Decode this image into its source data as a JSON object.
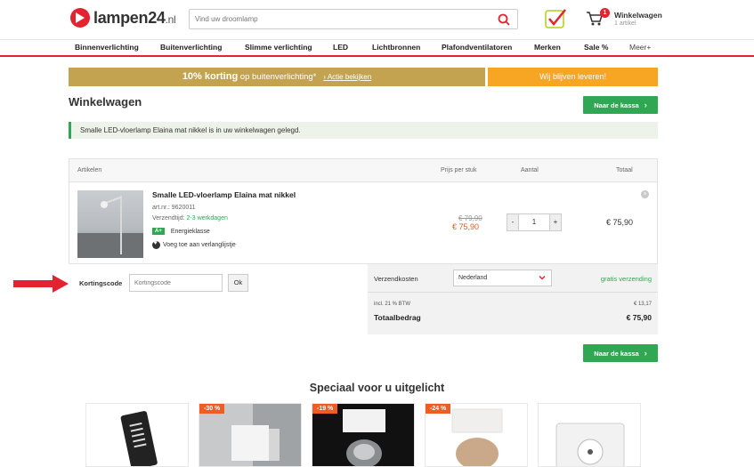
{
  "header": {
    "logo_text": "lampen24",
    "logo_ext": ".nl",
    "search_placeholder": "Vind uw droomlamp",
    "cart_title": "Winkelwagen",
    "cart_sub": "1 artikel",
    "cart_count": "1"
  },
  "nav": {
    "items": [
      "Binnenverlichting",
      "Buitenverlichting",
      "Slimme verlichting",
      "LED",
      "Lichtbronnen",
      "Plafondventilatoren",
      "Merken",
      "Sale %",
      "Meer+"
    ]
  },
  "promo": {
    "bold": "10% korting",
    "text": " op buitenverlichting*",
    "link": "› Actie bekijken",
    "right": "Wij blijven leveren!"
  },
  "page": {
    "title": "Winkelwagen",
    "checkout": "Naar de kassa",
    "notice": "Smalle LED-vloerlamp Elaina mat nikkel is in uw winkelwagen gelegd."
  },
  "table": {
    "headers": {
      "articles": "Artikelen",
      "unit_price": "Prijs per stuk",
      "qty": "Aantal",
      "total": "Totaal"
    },
    "item": {
      "name": "Smalle LED-vloerlamp Elaina mat nikkel",
      "art": "art.nr.: 9620011",
      "ship_label": "Verzendtijd:",
      "ship_time": "2-3 werkdagen",
      "energy_badge": "A+",
      "energy_label": "Energieklasse",
      "wishlist": "Voeg toe aan verlanglijstje",
      "old_price": "€ 79,90",
      "new_price": "€ 75,90",
      "qty_minus": "-",
      "qty": "1",
      "qty_plus": "+",
      "total": "€ 75,90",
      "remove": "×"
    }
  },
  "coupon": {
    "label": "Kortingscode",
    "placeholder": "Kortingscode",
    "button": "Ok"
  },
  "summary": {
    "shipping_label": "Verzendkosten",
    "country": "Nederland",
    "free": "gratis verzending",
    "vat_label": "incl. 21 % BTW",
    "vat_value": "€ 13,17",
    "total_label": "Totaalbedrag",
    "total_value": "€ 75,90"
  },
  "specials": {
    "title": "Speciaal voor u uitgelicht",
    "discounts": [
      "-30 %",
      "-19 %",
      "-24 %"
    ]
  },
  "colors": {
    "brand_red": "#e3232f",
    "green": "#2fa753",
    "promo_gold": "#c3a34f",
    "promo_orange": "#f6a623",
    "discount_orange": "#ef5d24"
  }
}
